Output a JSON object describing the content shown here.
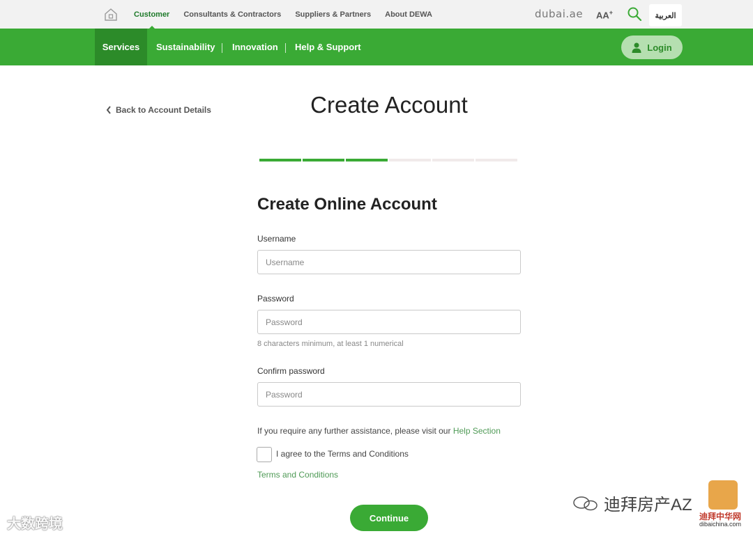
{
  "topbar": {
    "links": [
      "Customer",
      "Consultants & Contractors",
      "Suppliers & Partners",
      "About DEWA"
    ],
    "dubai_logo": "dubai.ae",
    "font_size_label": "AA",
    "font_size_sup": "+",
    "arabic_label": "العربية"
  },
  "nav": {
    "items": [
      "Services",
      "Sustainability",
      "Innovation",
      "Help & Support"
    ],
    "login_label": "Login"
  },
  "page": {
    "back_label": "Back to Account Details",
    "title": "Create Account",
    "progress": {
      "total_steps": 6,
      "completed_steps": 3
    }
  },
  "form": {
    "title": "Create Online Account",
    "username_label": "Username",
    "username_placeholder": "Username",
    "password_label": "Password",
    "password_placeholder": "Password",
    "password_hint": "8 characters minimum, at least 1 numerical",
    "confirm_label": "Confirm password",
    "confirm_placeholder": "Password",
    "assist_text": "If you require any further assistance, please visit our",
    "help_link": "Help Section",
    "agree_label": "I agree to the Terms and Conditions",
    "terms_link": "Terms and Conditions",
    "continue_label": "Continue"
  },
  "watermarks": {
    "left": "大数跨境",
    "right": "迪拜房产AZ",
    "site": "迪拜中华网",
    "domain": "dibaichina.com"
  },
  "colors": {
    "brand_green": "#3aaa35",
    "dark_green": "#2c8b29",
    "link_green": "#4f9a56"
  }
}
